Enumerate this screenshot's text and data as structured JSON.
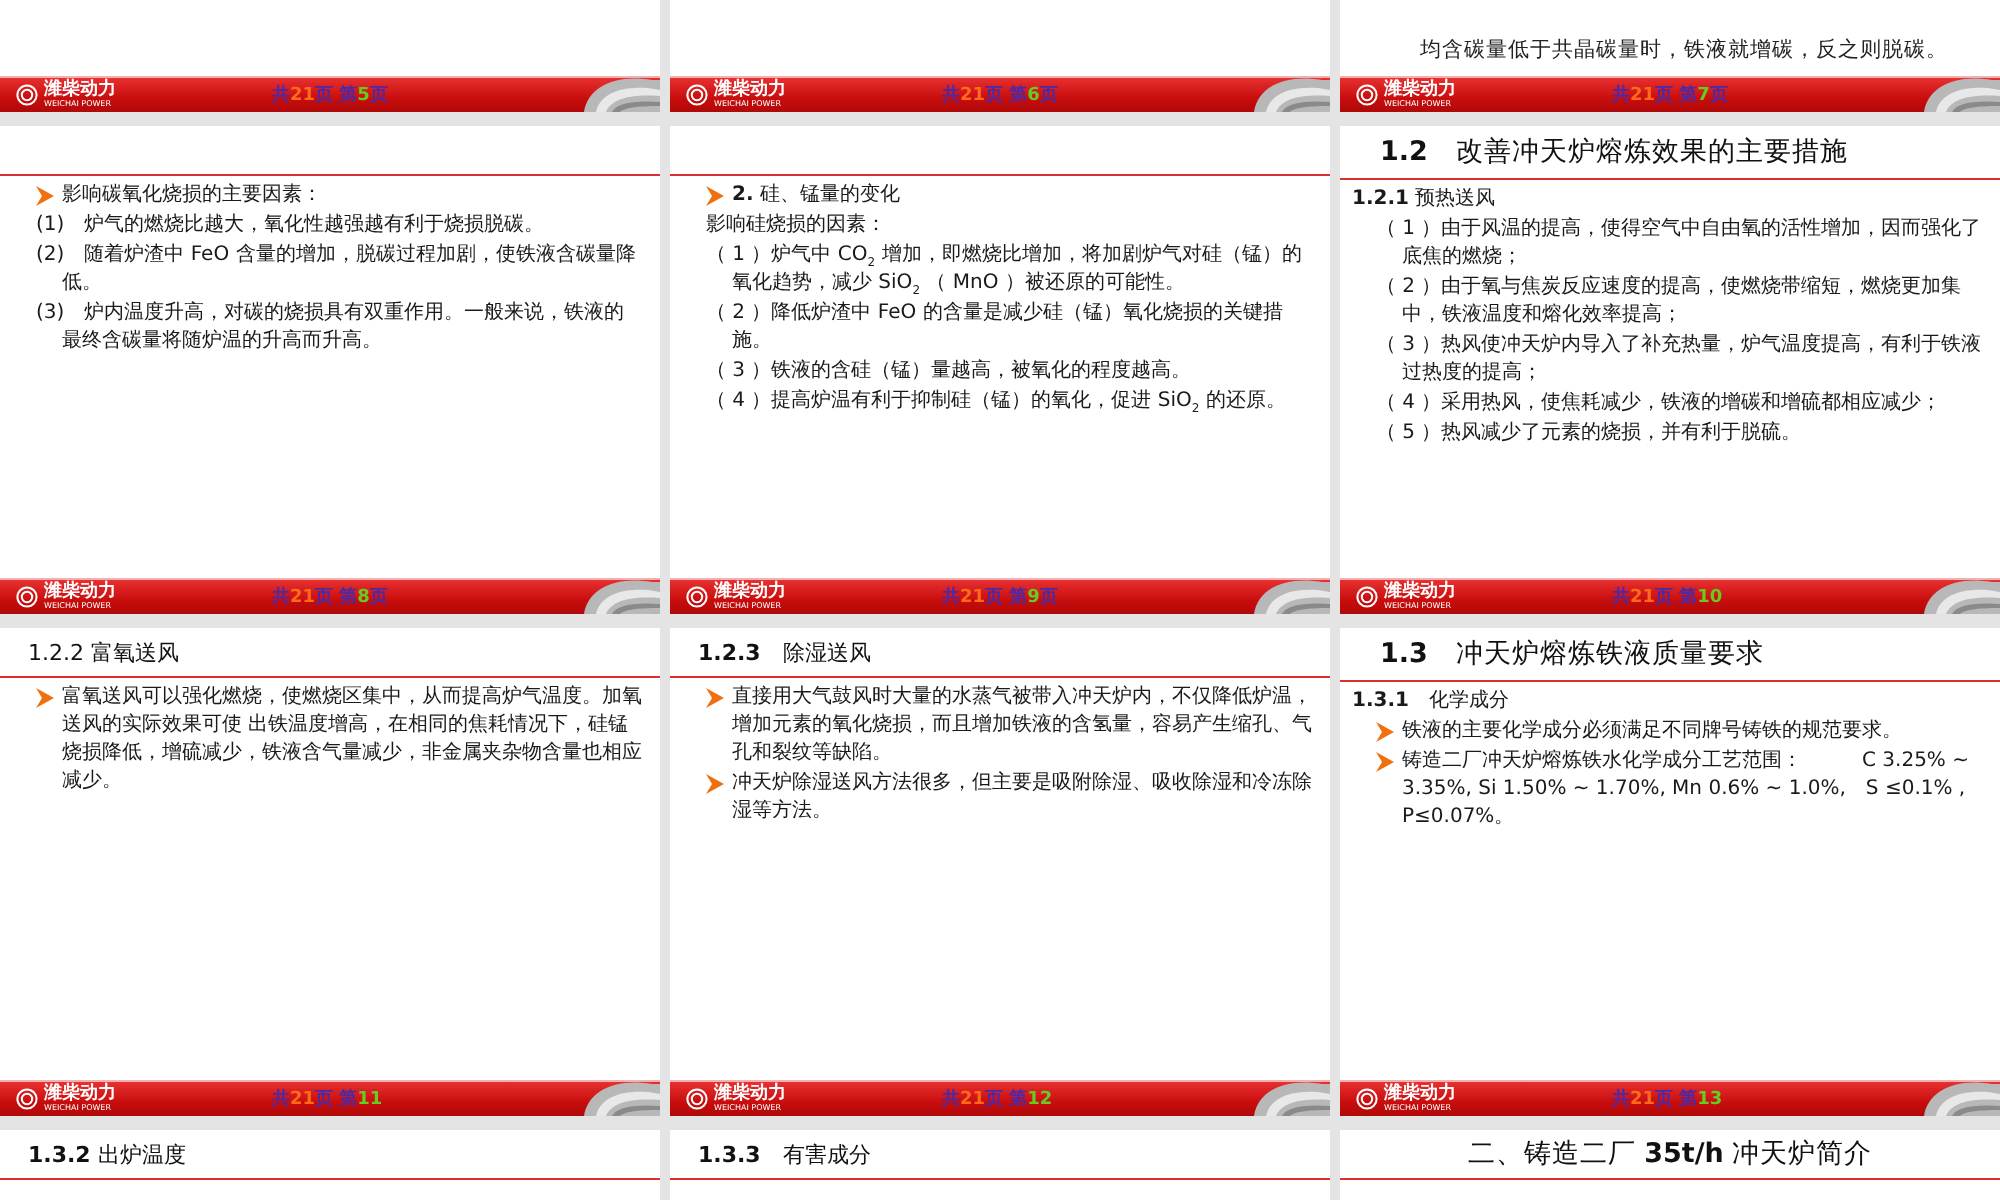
{
  "columns": [
    {
      "blocks": [
        {
          "kind": "fragment"
        },
        {
          "kind": "footer",
          "brand": "潍柴动力",
          "brand_sub": "WEICHAI POWER",
          "prefix": "共",
          "total": "21",
          "mid": "页 第",
          "page": "5",
          "suffix": "页"
        },
        {
          "kind": "slide",
          "items": [
            {
              "kind": "bullet",
              "text": "影响碳氧化烧损的主要因素："
            },
            {
              "kind": "numbered",
              "text": "(1)　炉气的燃烧比越大，氧化性越强越有利于烧损脱碳。"
            },
            {
              "kind": "numbered",
              "text": "(2)　随着炉渣中 FeO 含量的增加，脱碳过程加剧，使铁液含碳量降低。"
            },
            {
              "kind": "numbered",
              "text": "(3)　炉内温度升高，对碳的烧损具有双重作用。一般来说，铁液的最终含碳量将随炉温的升高而升高。"
            }
          ]
        },
        {
          "kind": "footer",
          "brand": "潍柴动力",
          "brand_sub": "WEICHAI POWER",
          "prefix": "共",
          "total": "21",
          "mid": "页 第",
          "page": "8",
          "suffix": "页"
        },
        {
          "kind": "slide",
          "title": {
            "kind": "small",
            "text": "1.2.2 富氧送风"
          },
          "items": [
            {
              "kind": "bullet",
              "text": "富氧送风可以强化燃烧，使燃烧区集中，从而提高炉气温度。加氧送风的实际效果可使 出铁温度增高，在相同的焦耗情况下，硅锰烧损降低，增硫减少，铁液含气量减少，非金属夹杂物含量也相应减少。"
            }
          ]
        },
        {
          "kind": "footer",
          "brand": "潍柴动力",
          "brand_sub": "WEICHAI POWER",
          "prefix": "共",
          "total": "21",
          "mid": "页 第",
          "page": "11"
        },
        {
          "kind": "slide",
          "title": {
            "kind": "small",
            "text": "**1.3.2** 出炉温度"
          }
        }
      ]
    },
    {
      "blocks": [
        {
          "kind": "fragment"
        },
        {
          "kind": "footer",
          "brand": "潍柴动力",
          "brand_sub": "WEICHAI POWER",
          "prefix": "共",
          "total": "21",
          "mid": "页 第",
          "page": "6",
          "suffix": "页"
        },
        {
          "kind": "slide",
          "items": [
            {
              "kind": "bullet",
              "text": "**2.** 硅、锰量的变化"
            },
            {
              "kind": "text",
              "text": "影响硅烧损的因素："
            },
            {
              "kind": "numbered",
              "text": "（ 1 ）炉气中 CO$_{2}$ 增加，即燃烧比增加，将加剧炉气对硅（锰）的氧化趋势，减少 SiO$_{2}$ （ MnO ）被还原的可能性。"
            },
            {
              "kind": "numbered",
              "text": "（ 2 ）降低炉渣中 FeO 的含量是减少硅（锰）氧化烧损的关键措施。"
            },
            {
              "kind": "numbered",
              "text": "（ 3 ）铁液的含硅（锰）量越高，被氧化的程度越高。"
            },
            {
              "kind": "numbered",
              "text": "（ 4 ）提高炉温有利于抑制硅（锰）的氧化，促进 SiO$_{2}$ 的还原。"
            }
          ]
        },
        {
          "kind": "footer",
          "brand": "潍柴动力",
          "brand_sub": "WEICHAI POWER",
          "prefix": "共",
          "total": "21",
          "mid": "页 第",
          "page": "9",
          "suffix": "页"
        },
        {
          "kind": "slide",
          "title": {
            "kind": "small",
            "text": "**1.2.3**　除湿送风"
          },
          "items": [
            {
              "kind": "bullet",
              "text": "直接用大气鼓风时大量的水蒸气被带入冲天炉内，不仅降低炉温，增加元素的氧化烧损，而且增加铁液的含氢量，容易产生缩孔、气孔和裂纹等缺陷。"
            },
            {
              "kind": "bullet",
              "text": "冲天炉除湿送风方法很多，但主要是吸附除湿、吸收除湿和冷冻除湿等方法。"
            }
          ]
        },
        {
          "kind": "footer",
          "brand": "潍柴动力",
          "brand_sub": "WEICHAI POWER",
          "prefix": "共",
          "total": "21",
          "mid": "页 第",
          "page": "12"
        },
        {
          "kind": "slide",
          "title": {
            "kind": "small",
            "text": "**1.3.3**　有害成分"
          }
        }
      ]
    },
    {
      "blocks": [
        {
          "kind": "fragment",
          "lines": [
            "均含碳量低于共晶碳量时，铁液就增碳，反之则脱碳。"
          ]
        },
        {
          "kind": "footer",
          "brand": "潍柴动力",
          "brand_sub": "WEICHAI POWER",
          "prefix": "共",
          "total": "21",
          "mid": "页 第",
          "page": "7",
          "suffix": "页"
        },
        {
          "kind": "slide",
          "title": {
            "kind": "large",
            "text": "**1.2**　改善冲天炉熔炼效果的主要措施"
          },
          "items": [
            {
              "kind": "subheading",
              "text": "**1.2.1** 预热送风"
            },
            {
              "kind": "numbered",
              "text": "（ 1 ）由于风温的提高，使得空气中自由氧的活性增加，因而强化了底焦的燃烧；"
            },
            {
              "kind": "numbered",
              "text": "（ 2 ）由于氧与焦炭反应速度的提高，使燃烧带缩短，燃烧更加集中，铁液温度和熔化效率提高；"
            },
            {
              "kind": "numbered",
              "text": "（ 3 ）热风使冲天炉内导入了补充热量，炉气温度提高，有利于铁液过热度的提高；"
            },
            {
              "kind": "numbered",
              "text": "（ 4 ）采用热风，使焦耗减少，铁液的增碳和增硫都相应减少；"
            },
            {
              "kind": "numbered",
              "text": "（ 5 ）热风减少了元素的烧损，并有利于脱硫。"
            }
          ]
        },
        {
          "kind": "footer",
          "brand": "潍柴动力",
          "brand_sub": "WEICHAI POWER",
          "prefix": "共",
          "total": "21",
          "mid": "页 第",
          "page": "10"
        },
        {
          "kind": "slide",
          "title": {
            "kind": "large",
            "text": "**1.3**　冲天炉熔炼铁液质量要求"
          },
          "items": [
            {
              "kind": "subheading",
              "text": "**1.3.1**　化学成分"
            },
            {
              "kind": "bullet",
              "text": "铁液的主要化学成分必须满足不同牌号铸铁的规范要求。"
            },
            {
              "kind": "bullet",
              "text": "铸造二厂冲天炉熔炼铁水化学成分工艺范围：　　　C 3.25% ~ 3.35%, Si 1.50% ~ 1.70%, Mn 0.6% ~ 1.0%,　S ≤0.1% , P≤0.07%。"
            }
          ]
        },
        {
          "kind": "footer",
          "brand": "潍柴动力",
          "brand_sub": "WEICHAI POWER",
          "prefix": "共",
          "total": "21",
          "mid": "页 第",
          "page": "13"
        },
        {
          "kind": "slide",
          "title": {
            "kind": "centered",
            "text": "二、铸造二厂 **35t/h** 冲天炉简介"
          }
        }
      ]
    }
  ]
}
